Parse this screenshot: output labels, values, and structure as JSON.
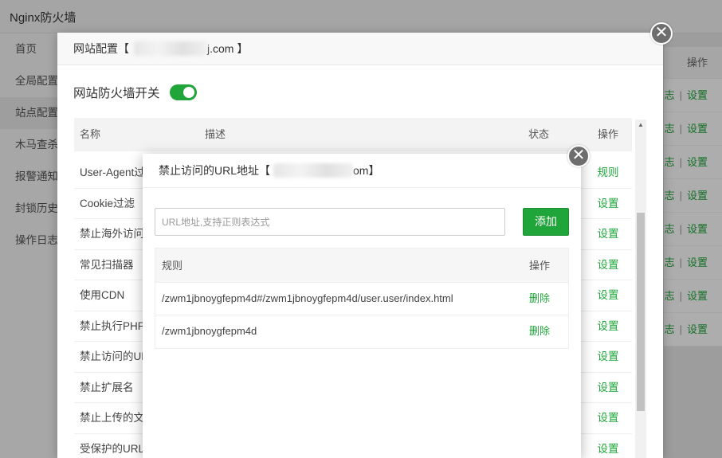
{
  "app": {
    "title": "Nginx防火墙"
  },
  "sidebar": {
    "items": [
      {
        "label": "首页"
      },
      {
        "label": "全局配置"
      },
      {
        "label": "站点配置"
      },
      {
        "label": "木马查杀"
      },
      {
        "label": "报警通知"
      },
      {
        "label": "封锁历史"
      },
      {
        "label": "操作日志"
      }
    ]
  },
  "bg_table": {
    "op_header": "操作",
    "row_link_a": "志",
    "row_sep": "|",
    "row_link_b": "设置"
  },
  "site_modal": {
    "title_prefix": "网站配置【",
    "title_suffix": "j.com 】",
    "switch_label": "网站防火墙开关",
    "switch_on": true,
    "columns": {
      "name": "名称",
      "desc": "描述",
      "status": "状态",
      "op": "操作"
    },
    "rows": [
      {
        "name": "User-Agent过",
        "op": "规则"
      },
      {
        "name": "Cookie过滤",
        "op": "设置"
      },
      {
        "name": "禁止海外访问",
        "op": "设置"
      },
      {
        "name": "常见扫描器",
        "op": "设置"
      },
      {
        "name": "使用CDN",
        "op": "设置"
      },
      {
        "name": "禁止执行PHP",
        "op": "设置"
      },
      {
        "name": "禁止访问的UR",
        "op": "设置"
      },
      {
        "name": "禁止扩展名",
        "op": "设置"
      },
      {
        "name": "禁止上传的文",
        "op": "设置"
      },
      {
        "name": "受保护的URL",
        "op": "设置"
      }
    ]
  },
  "url_modal": {
    "title_prefix": "禁止访问的URL地址【",
    "title_suffix": "om】",
    "input": {
      "placeholder": "URL地址,支持正则表达式",
      "value": ""
    },
    "add_label": "添加",
    "columns": {
      "rule": "规则",
      "op": "操作"
    },
    "rows": [
      {
        "rule": "/zwm1jbnoygfepm4d#/zwm1jbnoygfepm4d/user.user/index.html",
        "op": "删除"
      },
      {
        "rule": "/zwm1jbnoygfepm4d",
        "op": "删除"
      }
    ]
  },
  "close_glyph": "✕",
  "colors": {
    "accent": "#20a53a",
    "close_bg": "#6e6e6e"
  }
}
